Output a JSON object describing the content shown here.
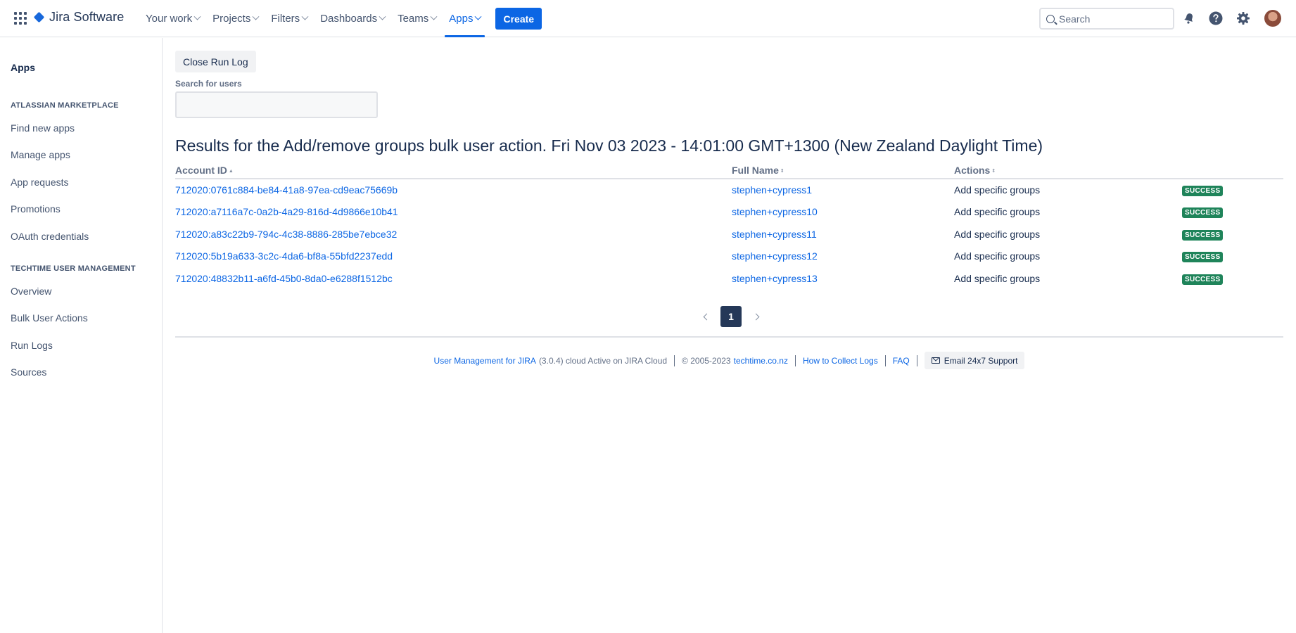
{
  "topnav": {
    "product_name": "Jira Software",
    "items": [
      {
        "label": "Your work",
        "active": false
      },
      {
        "label": "Projects",
        "active": false
      },
      {
        "label": "Filters",
        "active": false
      },
      {
        "label": "Dashboards",
        "active": false
      },
      {
        "label": "Teams",
        "active": false
      },
      {
        "label": "Apps",
        "active": true
      }
    ],
    "create_label": "Create",
    "search_placeholder": "Search",
    "icons": [
      "app-switcher-icon",
      "notifications-icon",
      "help-icon",
      "settings-icon",
      "avatar"
    ]
  },
  "sidebar": {
    "title": "Apps",
    "sections": [
      {
        "heading": "ATLASSIAN MARKETPLACE",
        "items": [
          "Find new apps",
          "Manage apps",
          "App requests",
          "Promotions",
          "OAuth credentials"
        ]
      },
      {
        "heading": "TECHTIME USER MANAGEMENT",
        "items": [
          "Overview",
          "Bulk User Actions",
          "Run Logs",
          "Sources"
        ]
      }
    ]
  },
  "main": {
    "close_button_label": "Close Run Log",
    "search_label": "Search for users",
    "search_value": "",
    "results_title": "Results for the Add/remove groups bulk user action. Fri Nov 03 2023 - 14:01:00 GMT+1300 (New Zealand Daylight Time)",
    "columns": [
      "Account ID",
      "Full Name",
      "Actions"
    ],
    "rows": [
      {
        "account_id": "712020:0761c884-be84-41a8-97ea-cd9eac75669b",
        "full_name": "stephen+cypress1",
        "action": "Add specific groups",
        "status": "SUCCESS"
      },
      {
        "account_id": "712020:a7116a7c-0a2b-4a29-816d-4d9866e10b41",
        "full_name": "stephen+cypress10",
        "action": "Add specific groups",
        "status": "SUCCESS"
      },
      {
        "account_id": "712020:a83c22b9-794c-4c38-8886-285be7ebce32",
        "full_name": "stephen+cypress11",
        "action": "Add specific groups",
        "status": "SUCCESS"
      },
      {
        "account_id": "712020:5b19a633-3c2c-4da6-bf8a-55bfd2237edd",
        "full_name": "stephen+cypress12",
        "action": "Add specific groups",
        "status": "SUCCESS"
      },
      {
        "account_id": "712020:48832b11-a6fd-45b0-8da0-e6288f1512bc",
        "full_name": "stephen+cypress13",
        "action": "Add specific groups",
        "status": "SUCCESS"
      }
    ],
    "pagination": {
      "current_page": "1"
    }
  },
  "footer": {
    "app_link": "User Management for JIRA",
    "app_info": "(3.0.4) cloud Active on JIRA Cloud",
    "copyright": "© 2005-2023",
    "site_link": "techtime.co.nz",
    "logs_link": "How to Collect Logs",
    "faq_link": "FAQ",
    "email_support": "Email 24x7 Support"
  },
  "colors": {
    "primary": "#0C66E4",
    "success": "#1F845A",
    "text": "#172B4D",
    "subtle": "#626F86"
  }
}
